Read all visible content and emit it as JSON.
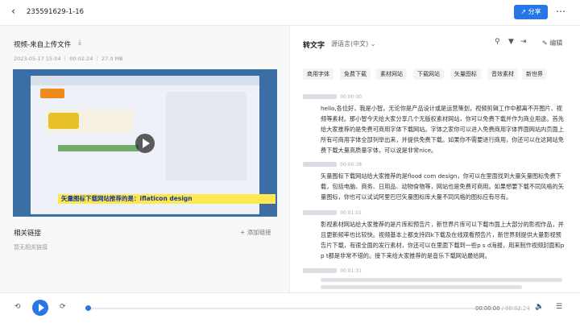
{
  "topbar": {
    "back_icon": "chevron-left-icon",
    "title": "235591629-1-16",
    "share_label": "分享",
    "more_icon": "more-icon"
  },
  "video_panel": {
    "title": "视频-来自上传文件",
    "download_icon": "download-icon",
    "meta": "2023-05-17 15:04 ｜ 00:02:24 ｜ 27.0 MB",
    "subtitle": "矢量图标下载网站推荐的是：iflaticon design",
    "related_title": "相关链接",
    "add_link_label": "添加链接",
    "empty_text": "暂无相关链接"
  },
  "transcript": {
    "title": "转文字",
    "language": "源语言(中文)",
    "edit_label": "编辑",
    "keywords": [
      "商用字体",
      "免费下载",
      "素材网站",
      "下载网站",
      "矢量图标",
      "音效素材",
      "新世界"
    ],
    "segments": [
      {
        "time": "00:00:00",
        "text": "hello,各位好，我是小智。无论你是产品设计或是运营策划，视频剪辑工作中都离不开图片、视频等素材。那小智今天给大家分享几个无版权素材网站，你可以免费下载并作为商业用途。首先给大家推荐的是免费可商用字体下载网站。字体之家你可以进入免费商用字体界面网站内页面上所有可商用字体全部列举出来，并提供免费下载。如果你不需要进行商用，你还可以在这网站免费下载大量高质量字体，可以说是非常nice。"
      },
      {
        "time": "00:00:38",
        "text": "矢量图标下载网站给大家推荐的是flood com design，你可以在里面找到大量矢量图标免费下载，包括电脑、商务、日用品、动物食物等，网站也是免费可商用。如果想要下载不同风格的矢量图标，你也可以试试阿里巴巴矢量图标库大量不同风格的图标应有尽有。"
      },
      {
        "time": "00:01:01",
        "text": "影视素材网站给大家推荐的是片库和预告片，新世界片库可以下载市面上大部分的影视作品，并且更新频率也比较快。视频基本上都支持四k下载及在线观看预告片，新世界则提供大量影视预告片下载，有很全面的发行素材，你还可以在里面下载到一些p s d海报，用来制作视频封面和p p t都是非常不错的。接下来给大家推荐的是音乐下载网站最给网。"
      },
      {
        "time": "00:01:31",
        "text": ""
      }
    ]
  },
  "player": {
    "rewind_icon": "rewind-15-icon",
    "play_icon": "play-icon",
    "forward_icon": "forward-15-icon",
    "current_time": "00:00:00",
    "duration": "/ 00:02:24",
    "progress": 0.0,
    "volume_icon": "volume-icon",
    "settings_icon": "settings-icon"
  }
}
